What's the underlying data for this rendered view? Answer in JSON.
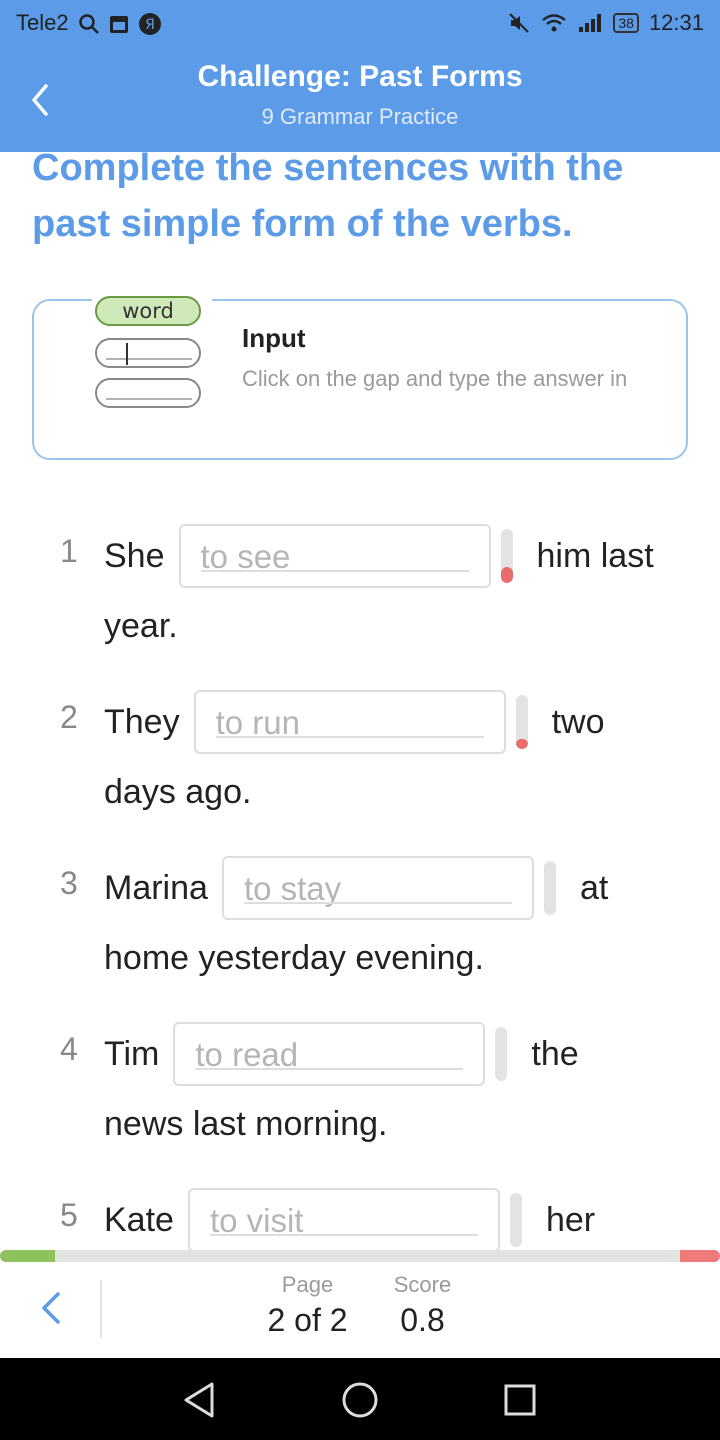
{
  "status_bar": {
    "carrier": "Tele2",
    "battery": "38",
    "time": "12:31"
  },
  "header": {
    "title": "Challenge: Past Forms",
    "subtitle": "9 Grammar Practice"
  },
  "task": {
    "instruction": "Complete the sentences with the past simple form of the verbs."
  },
  "hint": {
    "illustration_word": "word",
    "title": "Input",
    "text": "Click on the gap and type the answer in"
  },
  "exercises": [
    {
      "num": "1",
      "before": "She",
      "placeholder": "to see",
      "after": "him last",
      "cont": "year.",
      "meter_color": "#e86c6c"
    },
    {
      "num": "2",
      "before": "They",
      "placeholder": "to run",
      "after": "two",
      "cont": "days ago.",
      "meter_color": "#e86c6c"
    },
    {
      "num": "3",
      "before": "Marina",
      "placeholder": "to stay",
      "after": "at",
      "cont": "home yesterday evening.",
      "meter_color": "none"
    },
    {
      "num": "4",
      "before": "Tim",
      "placeholder": "to read",
      "after": "the",
      "cont": "news last morning.",
      "meter_color": "none"
    },
    {
      "num": "5",
      "before": "Kate",
      "placeholder": "to visit",
      "after": "her",
      "cont": "",
      "meter_color": "none"
    }
  ],
  "progress": {
    "correct_fraction": 0.076,
    "wrong_fraction": 0.056,
    "correct_color": "#8ec25c",
    "wrong_color": "#ef7a7a"
  },
  "bottom_nav": {
    "page_label": "Page",
    "page_value": "2 of 2",
    "score_label": "Score",
    "score_value": "0.8"
  },
  "colors": {
    "accent": "#5b9be8"
  },
  "icons": {
    "header_back": "chevron-left-icon",
    "bottom_back": "chevron-left-icon",
    "android_back": "triangle-back-icon",
    "android_home": "circle-home-icon",
    "android_recents": "square-recents-icon"
  }
}
